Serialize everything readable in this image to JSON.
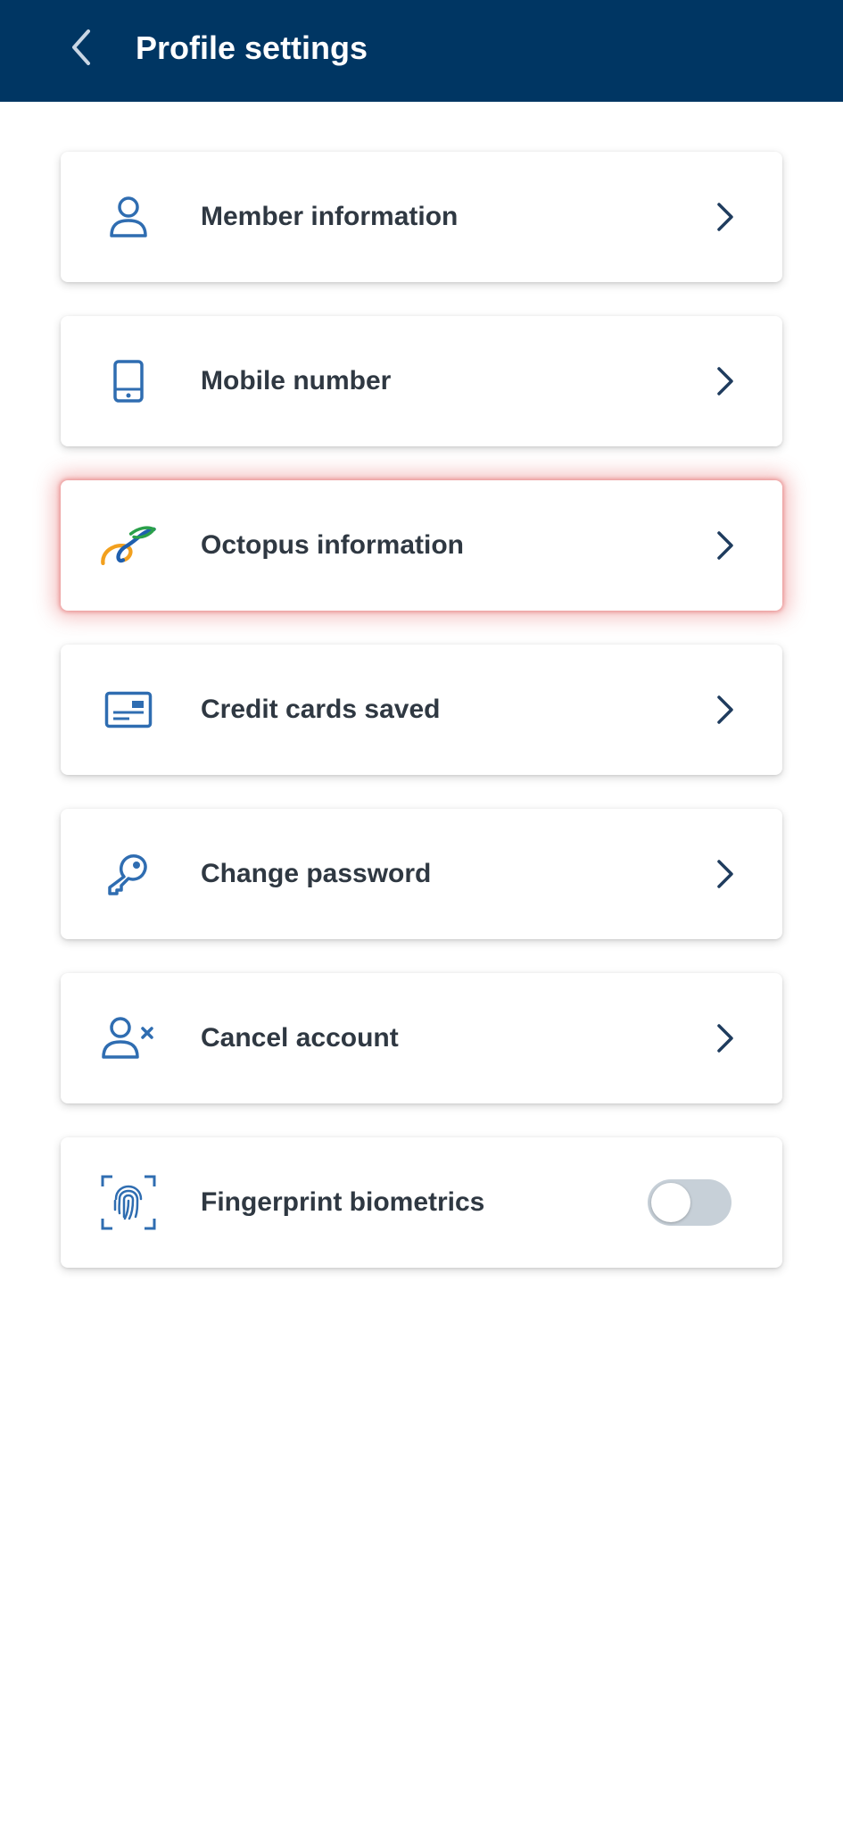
{
  "header": {
    "title": "Profile settings",
    "back_icon": "chevron-left-icon",
    "background": "#003663"
  },
  "menu": {
    "items": [
      {
        "id": "member-information",
        "label": "Member information",
        "icon": "person-icon",
        "accessory": "chevron-right-icon"
      },
      {
        "id": "mobile-number",
        "label": "Mobile number",
        "icon": "mobile-phone-icon",
        "accessory": "chevron-right-icon"
      },
      {
        "id": "octopus-information",
        "label": "Octopus information",
        "icon": "octopus-logo-icon",
        "accessory": "chevron-right-icon",
        "highlighted": true
      },
      {
        "id": "credit-cards-saved",
        "label": "Credit cards saved",
        "icon": "credit-card-icon",
        "accessory": "chevron-right-icon"
      },
      {
        "id": "change-password",
        "label": "Change password",
        "icon": "key-icon",
        "accessory": "chevron-right-icon"
      },
      {
        "id": "cancel-account",
        "label": "Cancel account",
        "icon": "person-remove-icon",
        "accessory": "chevron-right-icon"
      },
      {
        "id": "fingerprint-biometrics",
        "label": "Fingerprint biometrics",
        "icon": "fingerprint-icon",
        "accessory": "toggle",
        "toggle_on": false
      }
    ]
  },
  "colors": {
    "icon_blue": "#2f6db1",
    "chevron": "#1f3c5e",
    "label_text": "#2f3842",
    "highlight_glow": "#e87878",
    "toggle_off_track": "#c7d0d8"
  }
}
